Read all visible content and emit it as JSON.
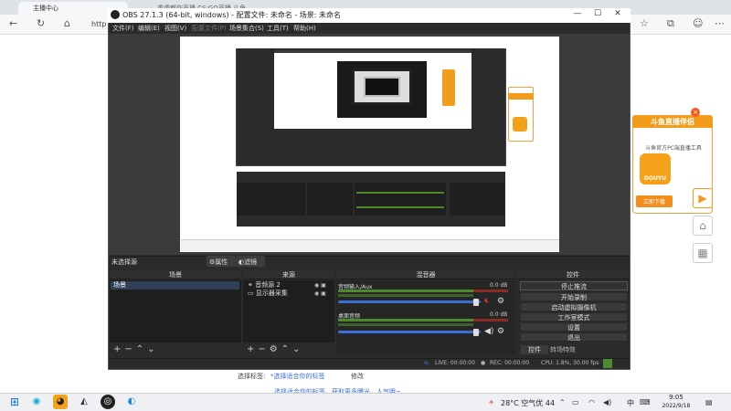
{
  "browser": {
    "tab_label": "主播中心",
    "tab2_label": "虎虎都作直播 CS:GO直播 斗鱼",
    "address_prefix": "http"
  },
  "page_bottom": {
    "label": "选择标签:",
    "hint": "*选择适合你的标签",
    "edit": "修改",
    "hint2": "选择适合你的标签，获取更多曝光，人气哦~"
  },
  "ad": {
    "banner": "斗鱼直播伴侣",
    "subtitle": "斗鱼官方PC端直播工具",
    "logo_text": "DOUYU",
    "button": "立即下载",
    "close": "×"
  },
  "obs": {
    "title": "OBS 27.1.3 (64-bit, windows) - 配置文件: 未命名 - 场景: 未命名",
    "menu": [
      "文件(F)",
      "编辑(E)",
      "视图(V)",
      "配置文件(P)",
      "场景集合(S)",
      "工具(T)",
      "帮助(H)"
    ],
    "no_source": "未选择源",
    "properties": "属性",
    "filters": "滤镜",
    "docks": {
      "scenes": "场景",
      "sources": "来源",
      "mixer": "混音器",
      "controls": "控件"
    },
    "scene_items": [
      "场景"
    ],
    "source_items": [
      "音频源 2",
      "显示器采集"
    ],
    "mixer": [
      {
        "name": "音频输入/Aux",
        "db": "0.0 dB"
      },
      {
        "name": "桌面音频",
        "db": "0.0 dB"
      }
    ],
    "controls": [
      "停止推流",
      "开始录制",
      "启动虚拟摄像机",
      "工作室模式",
      "设置",
      "退出"
    ],
    "control_tabs": [
      "控件",
      "转场特效"
    ],
    "status": {
      "live": "LIVE: 00:00:00",
      "rec": "REC: 00:00:00",
      "cpu": "CPU: 1.8%, 30.00 fps"
    }
  },
  "taskbar": {
    "weather": "28°C 空气优 44",
    "lang": "中",
    "time": "9:05",
    "date": "2022/9/18"
  },
  "colors": {
    "obs_bg": "#2b2b2b",
    "accent_blue": "#3a6fd8",
    "meter_green": "#4c8a2c",
    "meter_red": "#8c2b22",
    "douyu_orange": "#f39c1b"
  }
}
